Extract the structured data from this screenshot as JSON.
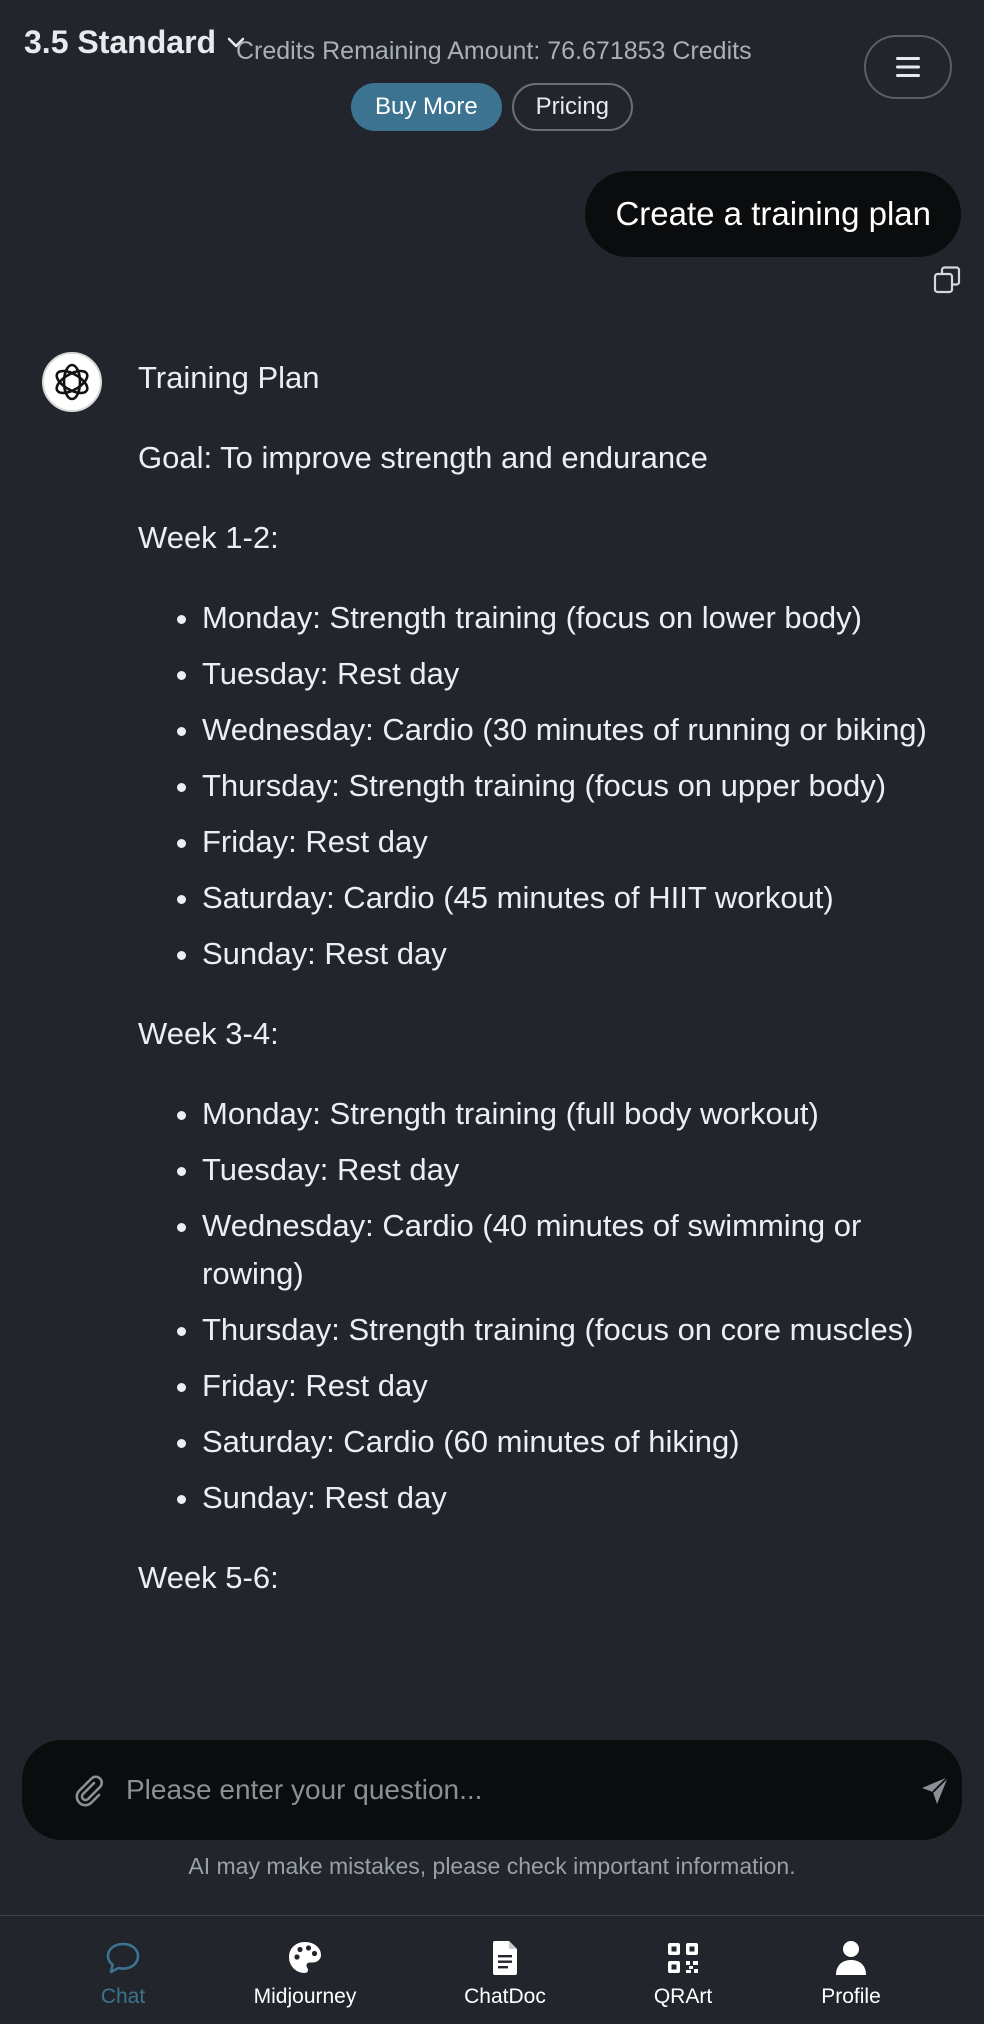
{
  "header": {
    "model": "3.5 Standard",
    "credits": "Credits Remaining Amount: 76.671853 Credits",
    "buy_more": "Buy More",
    "pricing": "Pricing"
  },
  "user_message": "Create a training plan",
  "answer": {
    "title": "Training Plan",
    "goal": "Goal: To improve strength and endurance",
    "weeks": [
      {
        "heading": "Week 1-2:",
        "items": [
          "Monday: Strength training (focus on lower body)",
          "Tuesday: Rest day",
          "Wednesday: Cardio (30 minutes of running or biking)",
          "Thursday: Strength training (focus on upper body)",
          "Friday: Rest day",
          "Saturday: Cardio (45 minutes of HIIT workout)",
          "Sunday: Rest day"
        ]
      },
      {
        "heading": "Week 3-4:",
        "items": [
          "Monday: Strength training (full body workout)",
          "Tuesday: Rest day",
          "Wednesday: Cardio (40 minutes of swimming or rowing)",
          "Thursday: Strength training (focus on core muscles)",
          "Friday: Rest day",
          "Saturday: Cardio (60 minutes of hiking)",
          "Sunday: Rest day"
        ]
      },
      {
        "heading": "Week 5-6:",
        "items": []
      }
    ]
  },
  "input": {
    "placeholder": "Please enter your question...",
    "value": ""
  },
  "disclaimer": "AI may make mistakes, please check important information.",
  "nav": {
    "active": "Chat",
    "items": [
      {
        "label": "Chat",
        "icon": "chat-bubble-icon"
      },
      {
        "label": "Midjourney",
        "icon": "palette-icon"
      },
      {
        "label": "ChatDoc",
        "icon": "document-icon"
      },
      {
        "label": "QRArt",
        "icon": "qr-code-icon"
      },
      {
        "label": "Profile",
        "icon": "person-icon"
      }
    ]
  },
  "colors": {
    "background": "#22252b",
    "accent": "#3c7390",
    "bubble": "#0b0c0d"
  }
}
